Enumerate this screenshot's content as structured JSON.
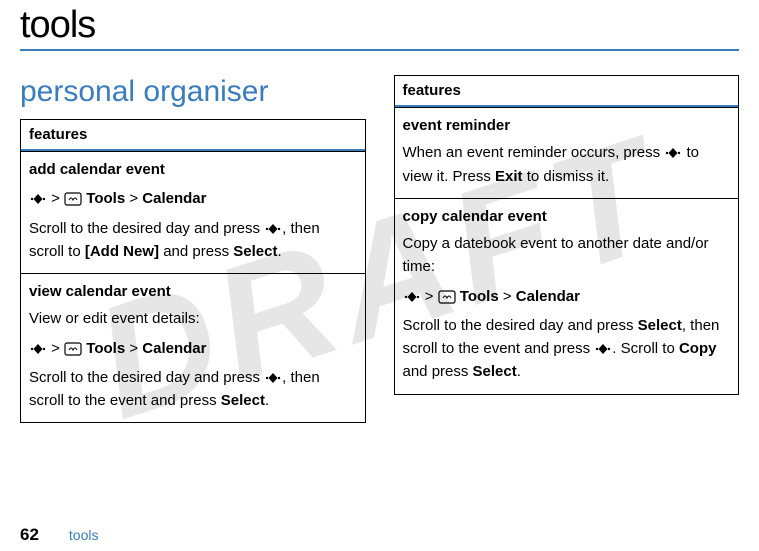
{
  "watermark": "DRAFT",
  "title": "tools",
  "section": "personal organiser",
  "tables": {
    "left": {
      "header": "features",
      "cells": [
        {
          "subhead": "add calendar event",
          "nav": {
            "tools": "Tools",
            "sep": ">",
            "calendar": "Calendar"
          },
          "body_pre": "Scroll to the desired day and press ",
          "body_mid": ", then scroll to ",
          "addnew": "[Add New]",
          "body_mid2": " and press ",
          "select": "Select",
          "body_end": "."
        },
        {
          "subhead": "view calendar event",
          "intro": "View or edit event details:",
          "nav": {
            "tools": "Tools",
            "sep": ">",
            "calendar": "Calendar"
          },
          "body_pre": "Scroll to the desired day and press ",
          "body_mid": ", then scroll to the event and press ",
          "select": "Select",
          "body_end": "."
        }
      ]
    },
    "right": {
      "header": "features",
      "cells": [
        {
          "subhead": "event reminder",
          "body_pre": "When an event reminder occurs, press ",
          "body_mid": " to view it. Press ",
          "exit": "Exit",
          "body_end": " to dismiss it."
        },
        {
          "subhead": "copy calendar event",
          "intro": "Copy a datebook event to another date and/or time:",
          "nav": {
            "tools": "Tools",
            "sep": ">",
            "calendar": "Calendar"
          },
          "body_pre": "Scroll to the desired day and press ",
          "select1": "Select",
          "body_mid": ", then scroll to the event and press ",
          "body_mid2": ". Scroll to ",
          "copy": "Copy",
          "body_mid3": " and press ",
          "select2": "Select",
          "body_end": "."
        }
      ]
    }
  },
  "footer": {
    "page": "62",
    "label": "tools"
  }
}
